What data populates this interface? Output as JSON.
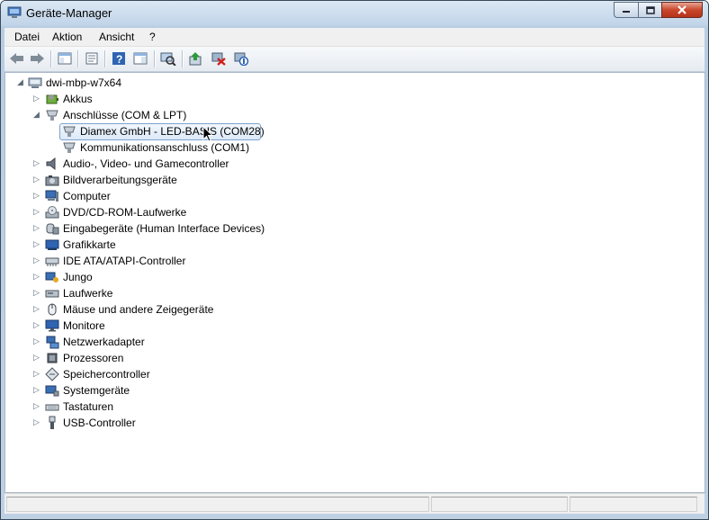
{
  "window": {
    "title": "Geräte-Manager"
  },
  "menu": [
    "Datei",
    "Aktion",
    "Ansicht",
    "?"
  ],
  "toolbar": {
    "buttons": [
      "back-icon",
      "forward-icon",
      "show-hide-tree-icon",
      "properties-icon",
      "help-icon",
      "action-pane-icon",
      "scan-hardware-icon",
      "update-driver-icon",
      "uninstall-icon",
      "disable-device-icon"
    ]
  },
  "tree": {
    "root": "dwi-mbp-w7x64",
    "categories": [
      {
        "label": "Akkus",
        "icon": "battery-icon",
        "expanded": false
      },
      {
        "label": "Anschlüsse (COM & LPT)",
        "icon": "port-icon",
        "expanded": true,
        "children": [
          {
            "label": "Diamex GmbH - LED-BASIS (COM28)",
            "selected": true
          },
          {
            "label": "Kommunikationsanschluss (COM1)",
            "selected": false
          }
        ]
      },
      {
        "label": "Audio-, Video- und Gamecontroller",
        "icon": "speaker-icon",
        "expanded": false
      },
      {
        "label": "Bildverarbeitungsgeräte",
        "icon": "camera-icon",
        "expanded": false
      },
      {
        "label": "Computer",
        "icon": "computer-icon",
        "expanded": false
      },
      {
        "label": "DVD/CD-ROM-Laufwerke",
        "icon": "disc-drive-icon",
        "expanded": false
      },
      {
        "label": "Eingabegeräte (Human Interface Devices)",
        "icon": "hid-icon",
        "expanded": false
      },
      {
        "label": "Grafikkarte",
        "icon": "display-adapter-icon",
        "expanded": false
      },
      {
        "label": "IDE ATA/ATAPI-Controller",
        "icon": "ide-controller-icon",
        "expanded": false
      },
      {
        "label": "Jungo",
        "icon": "jungo-icon",
        "expanded": false
      },
      {
        "label": "Laufwerke",
        "icon": "disk-drive-icon",
        "expanded": false
      },
      {
        "label": "Mäuse und andere Zeigegeräte",
        "icon": "mouse-icon",
        "expanded": false
      },
      {
        "label": "Monitore",
        "icon": "monitor-icon",
        "expanded": false
      },
      {
        "label": "Netzwerkadapter",
        "icon": "network-adapter-icon",
        "expanded": false
      },
      {
        "label": "Prozessoren",
        "icon": "processor-icon",
        "expanded": false
      },
      {
        "label": "Speichercontroller",
        "icon": "storage-controller-icon",
        "expanded": false
      },
      {
        "label": "Systemgeräte",
        "icon": "system-devices-icon",
        "expanded": false
      },
      {
        "label": "Tastaturen",
        "icon": "keyboard-icon",
        "expanded": false
      },
      {
        "label": "USB-Controller",
        "icon": "usb-icon",
        "expanded": false
      }
    ]
  },
  "colors": {
    "selection_border": "#7da2ce",
    "selection_fill": "#dce9f8",
    "close_red": "#c9472c"
  }
}
